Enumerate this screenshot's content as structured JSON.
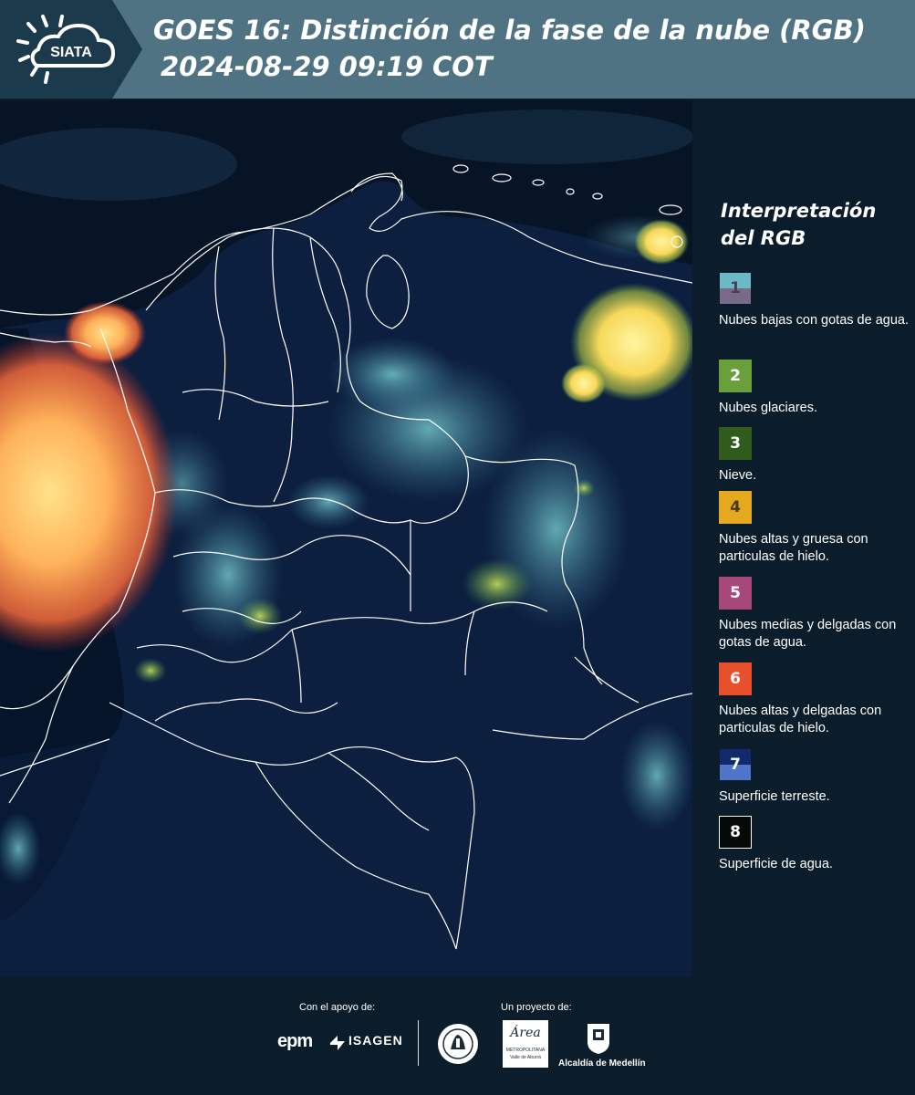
{
  "header": {
    "logo_text": "SIATA",
    "title_line1": "GOES 16: Distinción de la fase de la nube (RGB)",
    "title_line2": "2024-08-29 09:19 COT"
  },
  "map": {
    "ocean_color": "#071426",
    "land_color": "#0f2447",
    "border_color": "#ffffff"
  },
  "legend": {
    "title": "Interpretación del RGB",
    "items": [
      {
        "number": "1",
        "label": "Nubes bajas con gotas de agua.",
        "colors": [
          "#6bb9c7",
          "#7a6a8a"
        ],
        "num_color": "#4a3f57"
      },
      {
        "number": "2",
        "label": "Nubes glaciares.",
        "colors": [
          "#6aa03c"
        ],
        "num_color": "#ffffff"
      },
      {
        "number": "3",
        "label": "Nieve.",
        "colors": [
          "#2f5c1d"
        ],
        "num_color": "#ffffff"
      },
      {
        "number": "4",
        "label": "Nubes altas y gruesa con particulas de hielo.",
        "colors": [
          "#e4a91f"
        ],
        "num_color": "#4a3a10"
      },
      {
        "number": "5",
        "label": "Nubes medias y delgadas con gotas de agua.",
        "colors": [
          "#a6487a"
        ],
        "num_color": "#ffffff"
      },
      {
        "number": "6",
        "label": "Nubes altas y delgadas con particulas de hielo.",
        "colors": [
          "#e8502c"
        ],
        "num_color": "#ffffff"
      },
      {
        "number": "7",
        "label": "Superficie terreste.",
        "colors": [
          "#112a6b",
          "#4f74c9"
        ],
        "num_color": "#ffffff"
      },
      {
        "number": "8",
        "label": "Superficie de agua.",
        "colors": [
          "#050a08"
        ],
        "num_color": "#ffffff"
      }
    ]
  },
  "footer": {
    "support_label": "Con el apoyo de:",
    "project_label": "Un proyecto de:",
    "sponsor_epm": "epm",
    "sponsor_isagen": "ISAGEN",
    "sponsor_area_1": "Área",
    "sponsor_area_2": "METROPOLITANA",
    "sponsor_area_3": "Valle de Aburrá",
    "sponsor_alcaldia": "Alcaldía de Medellín"
  }
}
